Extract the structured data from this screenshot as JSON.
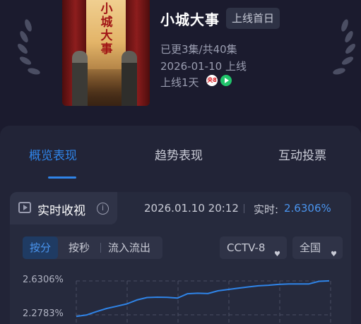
{
  "show": {
    "title": "小城大事",
    "premiere_tag": "上线首日",
    "poster_title": "小城大事",
    "episodes": "已更3集/共40集",
    "release": "2026-01-10 上线",
    "days_online": "上线1天",
    "channel_logo_text": "央8"
  },
  "tabs": [
    {
      "label": "概览表现",
      "active": true
    },
    {
      "label": "趋势表现",
      "active": false
    },
    {
      "label": "互动投票",
      "active": false
    }
  ],
  "realtime": {
    "title": "实时收视",
    "info_glyph": "i",
    "timestamp": "2026.01.10 20:12",
    "value_label": "实时:",
    "value": "2.6306%"
  },
  "filters": {
    "segments": [
      "按分",
      "按秒",
      "流入流出"
    ],
    "active_segment": "按分",
    "channel": "CCTV-8",
    "region": "全国",
    "dropdown_glyph": "♥"
  },
  "colors": {
    "accent": "#2f84e8",
    "background": "#1b1b2e",
    "card": "#222437",
    "line": "#2f84e8"
  },
  "icons": [
    "laurel-left-icon",
    "laurel-right-icon",
    "tv-play-icon",
    "info-icon",
    "cctv8-logo-icon",
    "video-app-logo-icon",
    "chevron-down-icon"
  ],
  "chart_data": {
    "type": "line",
    "y_tick_labels": [
      "2.6306%",
      "2.2783%"
    ],
    "y_ticks": [
      2.6306,
      2.2783
    ],
    "ylim": [
      2.2,
      2.66
    ],
    "grid": true,
    "series": [
      {
        "values": [
          2.262,
          2.276,
          2.312,
          2.344,
          2.368,
          2.392,
          2.433,
          2.458,
          2.462,
          2.46,
          2.452,
          2.498,
          2.503,
          2.499,
          2.528,
          2.542,
          2.556,
          2.568,
          2.58,
          2.586,
          2.595,
          2.6,
          2.6,
          2.6,
          2.627,
          2.631
        ]
      }
    ]
  }
}
